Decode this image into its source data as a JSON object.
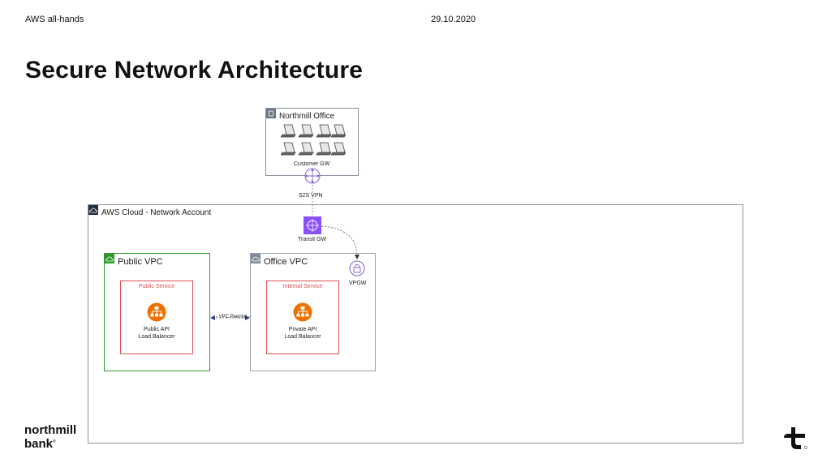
{
  "header": {
    "left": "AWS all-hands",
    "date": "29.10.2020"
  },
  "title": "Secure Network Architecture",
  "diagram": {
    "office": {
      "label": "Northmill Office",
      "customer_gw": "Customer GW"
    },
    "s2s_vpn": "S2S VPN",
    "aws_cloud": {
      "label": "AWS Cloud - Network Account"
    },
    "transit_gw": "Transit GW",
    "vpgw": "VPGW",
    "public_vpc": {
      "label": "Public VPC",
      "service": "Public Service",
      "lb_line1": "Public API",
      "lb_line2": "Load Balancer"
    },
    "office_vpc": {
      "label": "Office VPC",
      "service": "Internal Service",
      "lb_line1": "Private API",
      "lb_line2": "Load Balancer"
    },
    "vpc_peering": "- VPC Peering -"
  },
  "colors": {
    "aws_purple": "#8c4fff",
    "lb_orange": "#ed7100",
    "service_red": "#d9534f",
    "vpc_green": "#2e9b2e"
  },
  "logo": {
    "line1": "northmill",
    "line2": "bank"
  }
}
